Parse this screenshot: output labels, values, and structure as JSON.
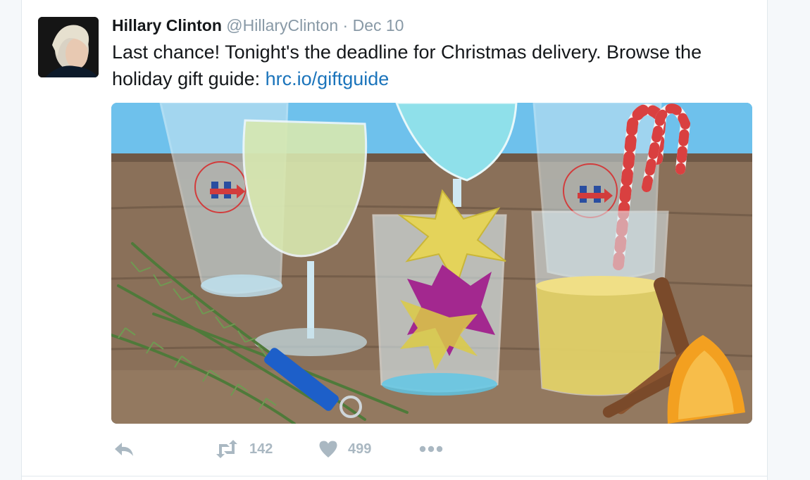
{
  "tweet": {
    "name": "Hillary Clinton",
    "handle": "@HillaryClinton",
    "separator": "·",
    "date": "Dec 10",
    "text_before_link": "Last chance! Tonight's the deadline for Christmas delivery. Browse the holiday gift guide: ",
    "link_text": "hrc.io/giftguide",
    "retweet_count": "142",
    "like_count": "499"
  },
  "icons": {
    "reply": "reply-icon",
    "retweet": "retweet-icon",
    "like": "heart-icon",
    "more": "more-icon"
  },
  "colors": {
    "name": "#14171a",
    "muted": "#8899a6",
    "link": "#1b74bb",
    "action": "#aab8c2"
  }
}
